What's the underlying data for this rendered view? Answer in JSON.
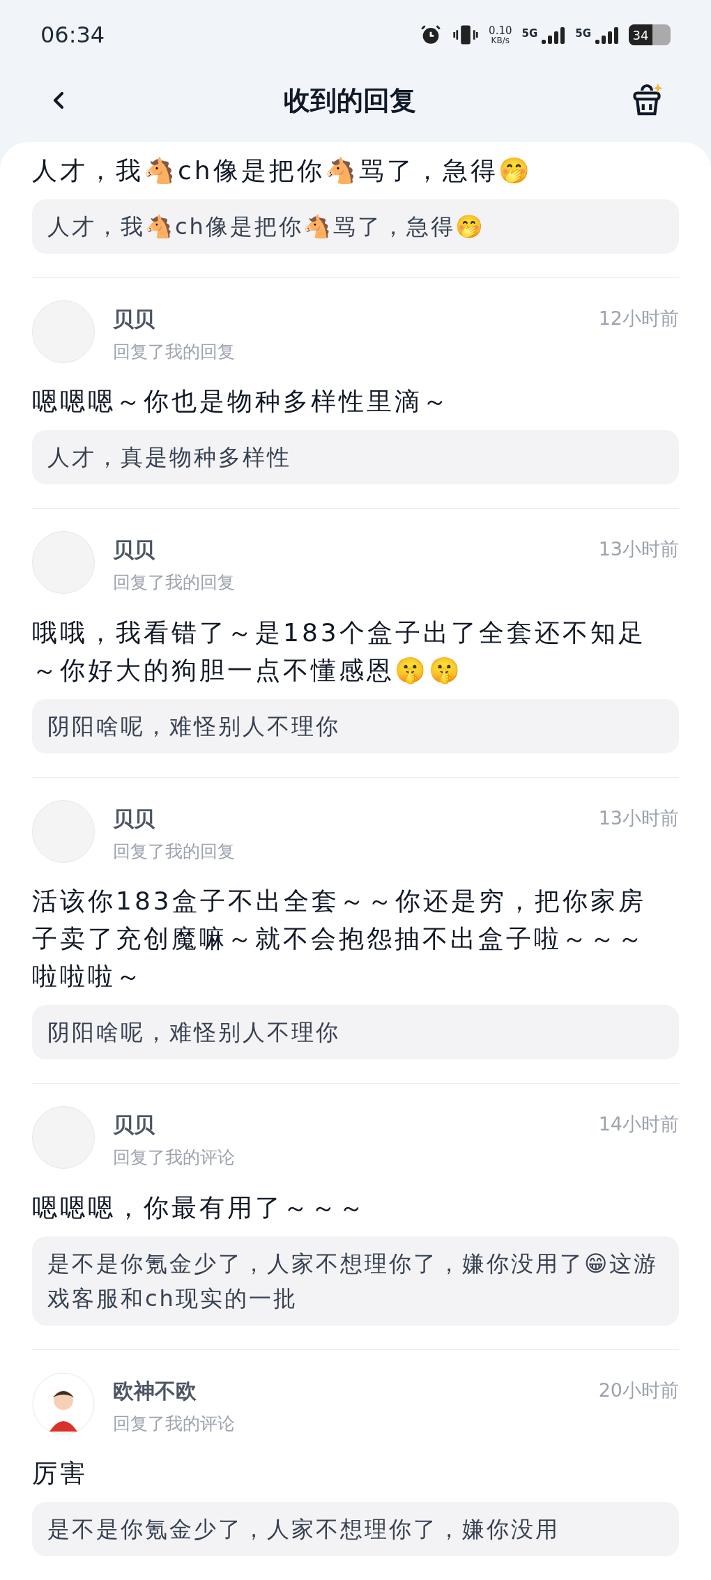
{
  "status_bar": {
    "time": "06:34",
    "net_speed": "0.10",
    "net_unit": "KB/s",
    "sim_1": "5G",
    "sim_2": "5G",
    "battery": "34"
  },
  "header": {
    "title": "收到的回复"
  },
  "replies": [
    {
      "kind": "continued",
      "text": "人才，我🐴ch像是把你🐴骂了，急得🤭",
      "quote": "人才，我🐴ch像是把你🐴骂了，急得🤭"
    },
    {
      "kind": "full",
      "author": "贝贝",
      "action": "回复了我的回复",
      "time": "12小时前",
      "avatar": {
        "kind": "text"
      },
      "text": "嗯嗯嗯～你也是物种多样性里滴～",
      "quote": "人才，真是物种多样性"
    },
    {
      "kind": "full",
      "author": "贝贝",
      "action": "回复了我的回复",
      "time": "13小时前",
      "avatar": {
        "kind": "text"
      },
      "text": "哦哦，我看错了～是183个盒子出了全套还不知足～你好大的狗胆一点不懂感恩🤫🤫",
      "quote": "阴阳啥呢，难怪别人不理你"
    },
    {
      "kind": "full",
      "author": "贝贝",
      "action": "回复了我的回复",
      "time": "13小时前",
      "avatar": {
        "kind": "text"
      },
      "text": "活该你183盒子不出全套～～你还是穷，把你家房子卖了充创魔嘛～就不会抱怨抽不出盒子啦～～～啦啦啦～",
      "quote": "阴阳啥呢，难怪别人不理你"
    },
    {
      "kind": "full",
      "author": "贝贝",
      "action": "回复了我的评论",
      "time": "14小时前",
      "avatar": {
        "kind": "text"
      },
      "text": "嗯嗯嗯，你最有用了～～～",
      "quote": "是不是你氪金少了，人家不想理你了，嫌你没用了😁这游戏客服和ch现实的一批"
    },
    {
      "kind": "full",
      "author": "欧神不欧",
      "action": "回复了我的评论",
      "time": "20小时前",
      "avatar": {
        "kind": "cartoon"
      },
      "text": "厉害",
      "quote": "是不是你氪金少了，人家不想理你了，嫌你没用"
    }
  ]
}
